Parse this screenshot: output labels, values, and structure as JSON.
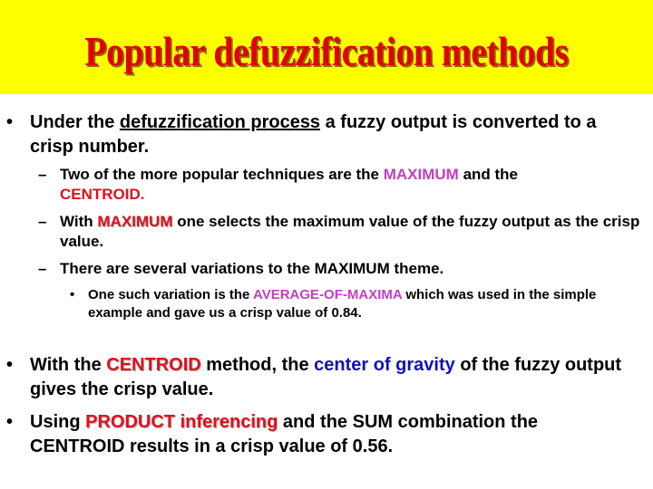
{
  "title": "Popular defuzzification methods",
  "colors": {
    "title_bg": "#ffff00",
    "title_text": "#e00000",
    "magenta": "#c040c0",
    "red": "#e0101c",
    "blue": "#1010c0"
  },
  "bullets": [
    {
      "marker": "•",
      "parts": [
        "Under the ",
        "defuzzification process",
        " a fuzzy output is converted to a crisp number."
      ]
    },
    {
      "marker": "–",
      "parts": [
        "Two of the more popular techniques are the ",
        "MAXIMUM",
        " and the ",
        "CENTROID."
      ]
    },
    {
      "marker": "–",
      "parts": [
        "With ",
        "MAXIMUM",
        " one selects the maximum value of the fuzzy output as the crisp value."
      ]
    },
    {
      "marker": "–",
      "parts": [
        "There are several variations to the MAXIMUM theme."
      ]
    },
    {
      "marker": "•",
      "parts": [
        " One such variation is the ",
        "AVERAGE-OF-MAXIMA",
        " which was used in the simple example and gave us a crisp value of 0.84."
      ]
    },
    {
      "marker": "•",
      "parts": [
        "With the ",
        "CENTROID",
        " method, the ",
        "center of gravity",
        " of the fuzzy output gives the crisp value."
      ]
    },
    {
      "marker": "•",
      "parts": [
        "Using ",
        "PRODUCT inferencing",
        " and the SUM combination the CENTROID results in a crisp value of 0.56."
      ]
    }
  ]
}
